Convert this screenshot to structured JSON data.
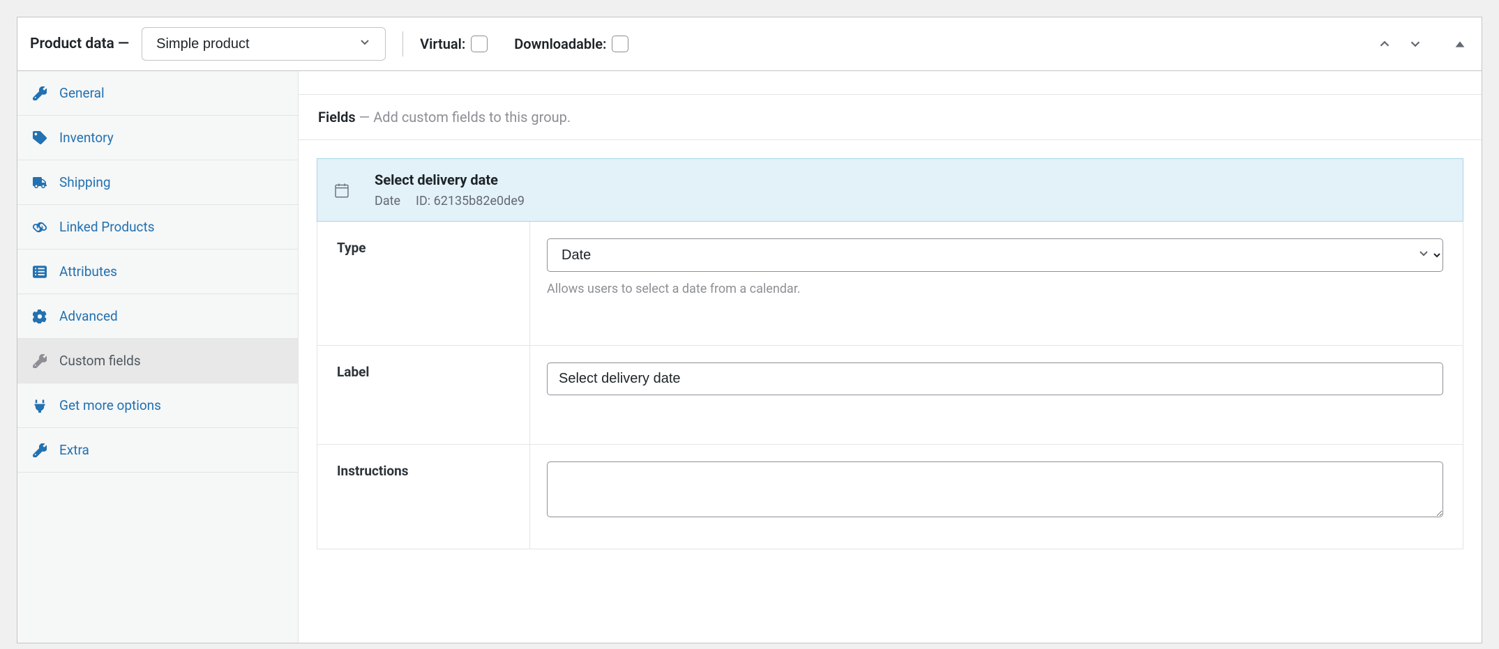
{
  "header": {
    "title": "Product data —",
    "product_type": "Simple product",
    "virtual_label": "Virtual:",
    "downloadable_label": "Downloadable:"
  },
  "sidebar": {
    "items": [
      {
        "label": "General",
        "icon": "wrench"
      },
      {
        "label": "Inventory",
        "icon": "tag"
      },
      {
        "label": "Shipping",
        "icon": "truck"
      },
      {
        "label": "Linked Products",
        "icon": "link"
      },
      {
        "label": "Attributes",
        "icon": "list"
      },
      {
        "label": "Advanced",
        "icon": "gear"
      },
      {
        "label": "Custom fields",
        "icon": "wrench",
        "active": true
      },
      {
        "label": "Get more options",
        "icon": "plug"
      },
      {
        "label": "Extra",
        "icon": "wrench"
      }
    ]
  },
  "fields_header": {
    "label": "Fields",
    "sep": " — ",
    "hint": "Add custom fields to this group."
  },
  "field_card": {
    "title": "Select delivery date",
    "type_badge": "Date",
    "id_label": "ID:",
    "id_value": "62135b82e0de9"
  },
  "form": {
    "type": {
      "label": "Type",
      "value": "Date",
      "help": "Allows users to select a date from a calendar."
    },
    "label": {
      "label": "Label",
      "value": "Select delivery date"
    },
    "instructions": {
      "label": "Instructions",
      "value": ""
    }
  }
}
